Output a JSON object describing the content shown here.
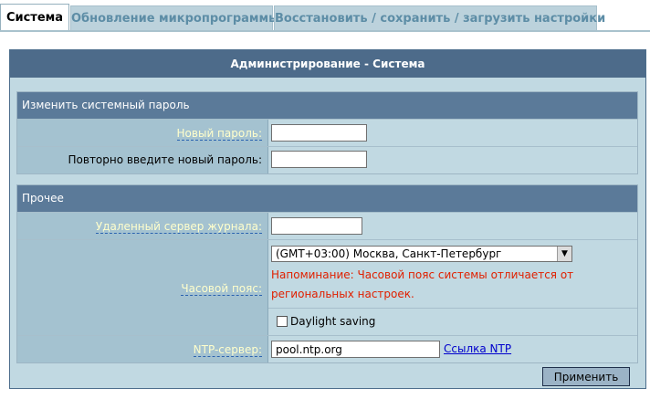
{
  "tabs": [
    {
      "label": "Система",
      "active": true
    },
    {
      "label": "Обновление микропрограммы",
      "active": false
    },
    {
      "label": "Восстановить / сохранить / загрузить настройки",
      "active": false
    }
  ],
  "panel": {
    "title": "Администрирование - Система",
    "password_section": {
      "title": "Изменить системный пароль",
      "new_password_label": "Новый пароль:",
      "new_password_value": "",
      "repeat_password_label": "Повторно введите новый пароль:",
      "repeat_password_value": ""
    },
    "misc_section": {
      "title": "Прочее",
      "remote_log_label": "Удаленный сервер журнала:",
      "remote_log_value": "",
      "timezone_label": "Часовой пояс:",
      "timezone_value": "(GMT+03:00) Москва, Санкт-Петербург",
      "timezone_warning": "Напоминание: Часовой пояс системы отличается от региональных настроек.",
      "daylight_label": "Daylight saving",
      "daylight_checked": false,
      "ntp_label": "NTP-сервер:",
      "ntp_value": "pool.ntp.org",
      "ntp_link": "Ссылка NTP"
    },
    "apply_label": "Применить"
  },
  "colors": {
    "header_bg": "#4d6b8a",
    "section_header_bg": "#5b7a99",
    "label_bg": "#a4c2d0",
    "value_bg": "#c1d9e2",
    "hint_text": "#ffffcc",
    "warning_text": "#e02000",
    "link": "#0000cc"
  }
}
